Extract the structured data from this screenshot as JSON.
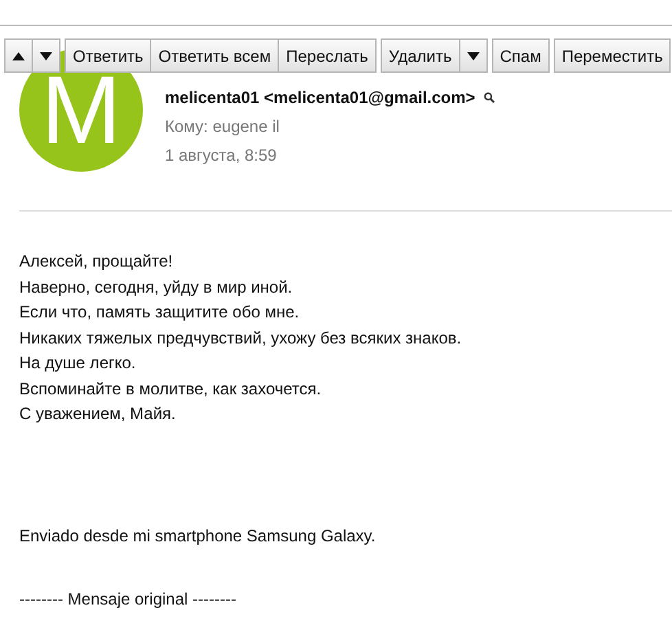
{
  "toolbar": {
    "nav": [
      {
        "kind": "up"
      },
      {
        "kind": "down"
      }
    ],
    "groups": [
      [
        "Ответить",
        "Ответить всем",
        "Переслать"
      ],
      [
        "Удалить"
      ],
      [
        "Спам"
      ],
      [
        "Переместить"
      ]
    ]
  },
  "message": {
    "avatar_letter": "M",
    "sender": "melicenta01 <melicenta01@gmail.com>",
    "to": "Кому: eugene il",
    "date": "1 августа, 8:59",
    "body": [
      [
        "Алексей, прощайте!",
        "Наверно, сегодня, уйду в мир иной.",
        "Если что, память защитите обо мне.",
        "Никаких тяжелых предчувствий, ухожу без всяких знаков.",
        "На душе легко.",
        "Вспоминайте в молитве, как захочется.",
        "С уважением, Майя."
      ],
      [
        "Enviado desde mi smartphone Samsung Galaxy."
      ],
      [
        "-------- Mensaje original --------"
      ]
    ]
  }
}
